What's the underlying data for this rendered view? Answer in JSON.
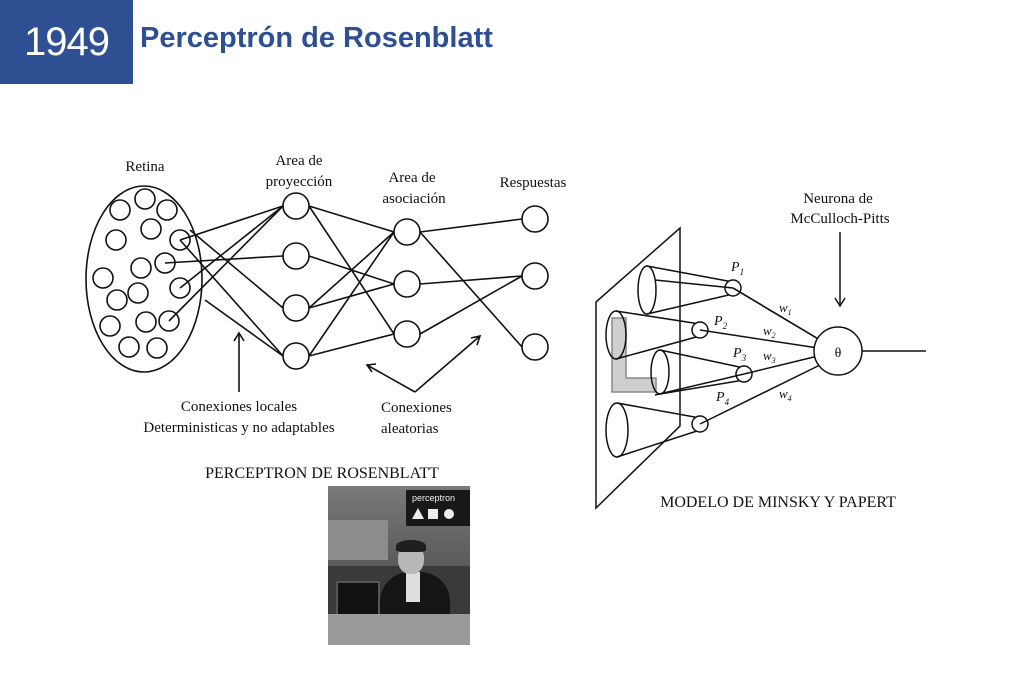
{
  "header": {
    "year": "1949",
    "title": "Perceptrón de Rosenblatt"
  },
  "left_diagram": {
    "retina_label": "Retina",
    "projection_label_1": "Area de",
    "projection_label_2": "proyección",
    "association_label_1": "Area de",
    "association_label_2": "asociación",
    "responses_label": "Respuestas",
    "local_connections_1": "Conexiones locales",
    "local_connections_2": "Deterministicas y no adaptables",
    "random_connections_1": "Conexiones",
    "random_connections_2": "aleatorias",
    "caption": "PERCEPTRON DE ROSENBLATT"
  },
  "right_diagram": {
    "neuron_label_1": "Neurona de",
    "neuron_label_2": "McCulloch-Pitts",
    "theta": "θ",
    "predicates": [
      "P",
      "P",
      "P",
      "P"
    ],
    "predicate_subscripts": [
      "1",
      "2",
      "3",
      "4"
    ],
    "weights": [
      "w",
      "w",
      "w",
      "w"
    ],
    "weight_subscripts": [
      "1",
      "2",
      "3",
      "4"
    ],
    "caption": "MODELO DE MINSKY Y PAPERT"
  },
  "photo": {
    "sign_text": "perceptron"
  }
}
